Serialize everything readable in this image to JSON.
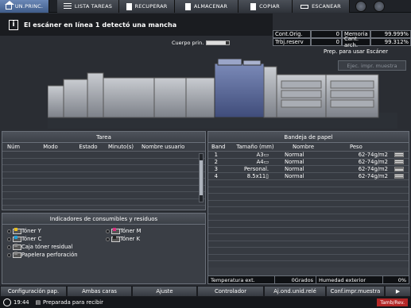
{
  "tabs": [
    {
      "label": "UN.PRINC.",
      "icon": "home-icon",
      "active": true
    },
    {
      "label": "LISTA TAREAS",
      "icon": "list-icon"
    },
    {
      "label": "RECUPERAR",
      "icon": "recover-icon"
    },
    {
      "label": "ALMACENAR",
      "icon": "store-icon"
    },
    {
      "label": "COPIAR",
      "icon": "copy-icon"
    },
    {
      "label": "ESCANEAR",
      "icon": "scan-icon"
    }
  ],
  "message": "El escáner en línea 1 detectó una mancha",
  "counters": {
    "cont_orig_label": "Cont.Orig.",
    "cont_orig_value": "0",
    "memoria_label": "Memoria",
    "memoria_value": "99.999%",
    "trbj_label": "Trbj.reserv",
    "trbj_value": "0",
    "cant_label": "Cant. arch.",
    "cant_value": "99.312%"
  },
  "cuerpo_label": "Cuerpo prin.",
  "prep_text": "Prep. para usar Escáner",
  "ejec_button": "Ejec. impr. muestra",
  "tarea": {
    "title": "Tarea",
    "columns": [
      "Núm",
      "Modo",
      "Estado",
      "Minuto(s)",
      "Nombre usuario"
    ]
  },
  "consumibles": {
    "title": "Indicadores de consumibles y residuos",
    "items": [
      {
        "label": "Tóner Y",
        "color": "#e8c020"
      },
      {
        "label": "Tóner M",
        "color": "#d83080"
      },
      {
        "label": "Tóner C",
        "color": "#20a0d8"
      },
      {
        "label": "Tóner K",
        "color": "#222222"
      },
      {
        "label": "Caja tóner residual",
        "color": "#888888"
      },
      {
        "label": "Papelera perforación",
        "color": "#888888"
      }
    ]
  },
  "bandeja": {
    "title": "Bandeja de papel",
    "columns": [
      "Band",
      "Tamaño (mm)",
      "Nombre",
      "Peso"
    ],
    "rows": [
      {
        "band": "1",
        "size": "A3▭",
        "name": "Normal",
        "weight": "62-74g/m2"
      },
      {
        "band": "2",
        "size": "A4▭",
        "name": "Normal",
        "weight": "62-74g/m2"
      },
      {
        "band": "3",
        "size": "Personal.",
        "name": "Normal",
        "weight": "62-74g/m2"
      },
      {
        "band": "4",
        "size": "8.5x11▯",
        "name": "Normal",
        "weight": "62-74g/m2"
      }
    ],
    "temp_label": "Temperatura ext.",
    "temp_value": "0Grados",
    "hum_label": "Humedad exterior",
    "hum_value": "0%"
  },
  "bottom_buttons": [
    "Configuración pap.",
    "Ambas caras",
    "Ajuste",
    "Controlador",
    "Aj.ond.unid.relé",
    "Conf.impr.muestra"
  ],
  "status": {
    "time": "19:44",
    "text": "Preparada para recibir",
    "badge": "Tamb/Rev."
  }
}
